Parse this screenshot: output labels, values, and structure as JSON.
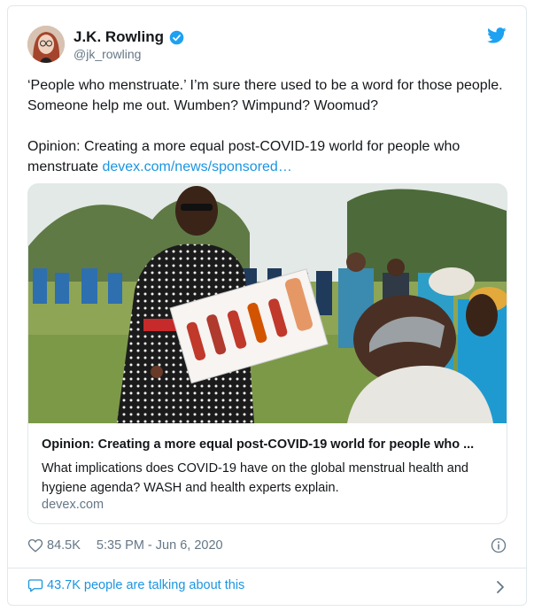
{
  "author": {
    "display_name": "J.K. Rowling",
    "handle": "@jk_rowling"
  },
  "tweet": {
    "line1": "‘People who menstruate.’ I’m sure there used to be a word for those people. Someone help me out. Wumben? Wimpund? Woomud?",
    "line2_text": "Opinion: Creating a more equal post-COVID-19 world for people who menstruate ",
    "line2_link": "devex.com/news/sponsored…"
  },
  "link_card": {
    "title": "Opinion: Creating a more equal post-COVID-19 world for people who ...",
    "description": "What implications does COVID-19 have on the global menstrual health and hygiene agenda? WASH and health experts explain.",
    "domain": "devex.com"
  },
  "meta": {
    "likes": "84.5K",
    "timestamp": "5:35 PM - Jun 6, 2020"
  },
  "footer": {
    "talking": "43.7K people are talking about this"
  },
  "colors": {
    "accent": "#1da1f2",
    "link": "#1b95e0",
    "secondary_text": "#657786"
  },
  "icons": [
    "verified-badge-icon",
    "twitter-bird-icon",
    "heart-icon",
    "info-icon",
    "speech-bubble-icon",
    "chevron-right-icon"
  ]
}
